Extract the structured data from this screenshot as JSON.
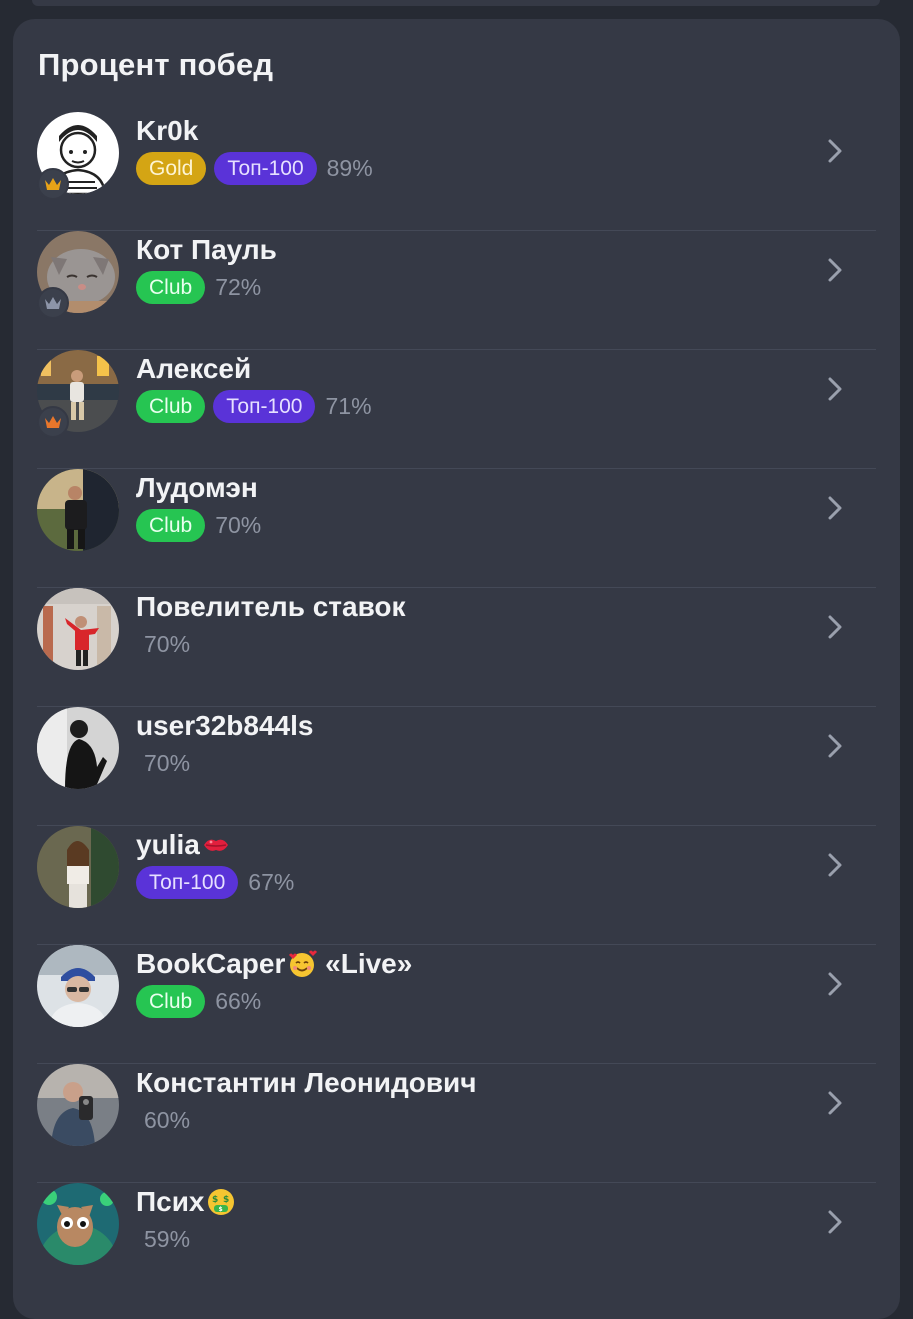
{
  "title": "Процент побед",
  "players": [
    {
      "name": "Kr0k",
      "emoji": "",
      "badges": [
        "Gold",
        "Топ-100"
      ],
      "percent": "89%",
      "crown": "gold"
    },
    {
      "name": "Кот Пауль",
      "emoji": "",
      "badges": [
        "Club"
      ],
      "percent": "72%",
      "crown": "silver"
    },
    {
      "name": "Алексей",
      "emoji": "",
      "badges": [
        "Club",
        "Топ-100"
      ],
      "percent": "71%",
      "crown": "bronze"
    },
    {
      "name": "Лудомэн",
      "emoji": "",
      "badges": [
        "Club"
      ],
      "percent": "70%",
      "crown": ""
    },
    {
      "name": "Повелитель ставок",
      "emoji": "",
      "badges": [],
      "percent": "70%",
      "crown": ""
    },
    {
      "name": "user32b844ls",
      "emoji": "",
      "badges": [],
      "percent": "70%",
      "crown": ""
    },
    {
      "name": "yulia",
      "emoji": "kiss-mark-emoji",
      "badges": [
        "Топ-100"
      ],
      "percent": "67%",
      "crown": ""
    },
    {
      "name": "BookCaper",
      "name_suffix": " «Live»",
      "emoji": "smiling-face-with-hearts-emoji",
      "badges": [
        "Club"
      ],
      "percent": "66%",
      "crown": ""
    },
    {
      "name": "Константин Леонидович",
      "emoji": "",
      "badges": [],
      "percent": "60%",
      "crown": ""
    },
    {
      "name": "Псих",
      "emoji": "money-mouth-face-emoji",
      "badges": [],
      "percent": "59%",
      "crown": ""
    }
  ],
  "colors": {
    "background": "#262a33",
    "card": "#353945",
    "gold_badge": "#d4a514",
    "club_badge": "#26c552",
    "top100_badge": "#5a33d8",
    "crown_gold": "#e8a317",
    "crown_silver": "#8d95a8",
    "crown_bronze": "#e8762b"
  },
  "icons": {
    "chevron": "chevron-right-icon",
    "crown": "crown-icon"
  }
}
